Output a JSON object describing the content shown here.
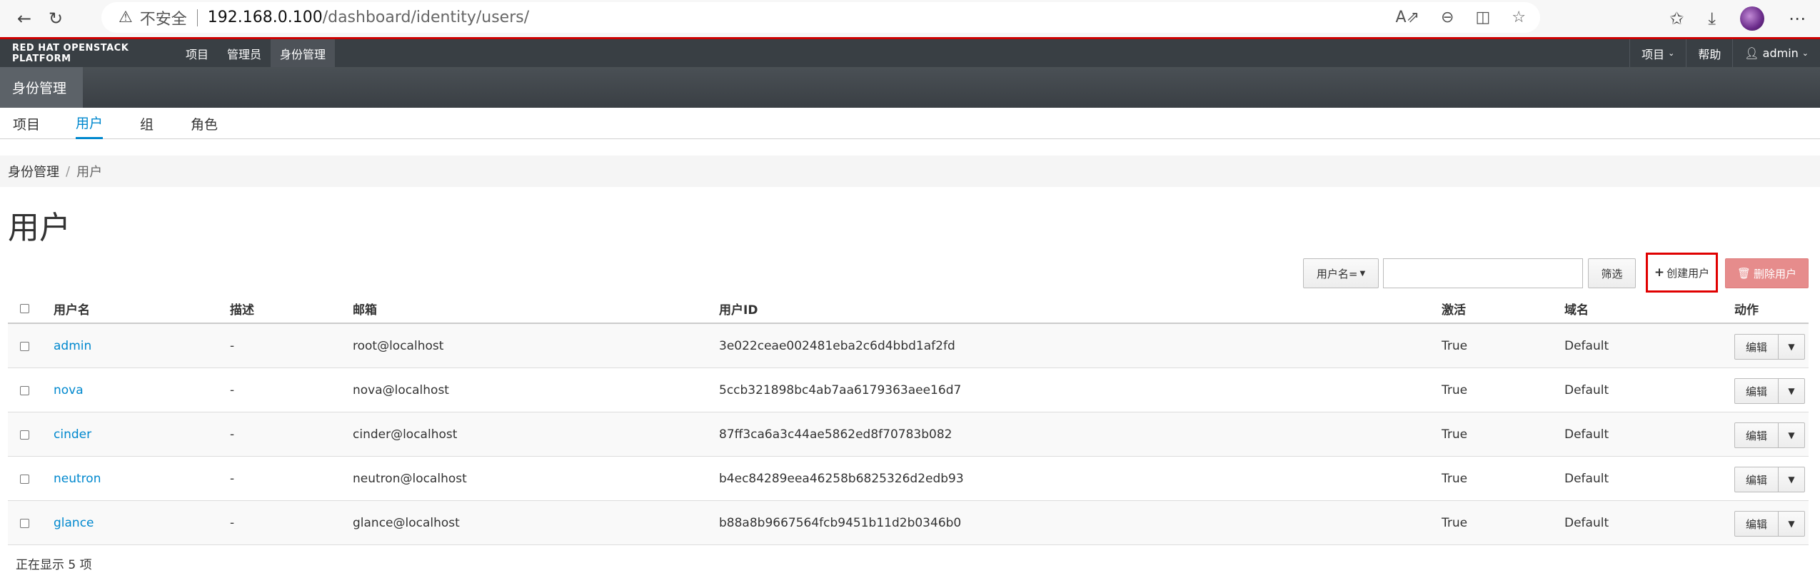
{
  "browser": {
    "insecure_label": "不安全",
    "url_host": "192.168.0.100",
    "url_path": "/dashboard/identity/users/"
  },
  "topbar": {
    "brand": "RED HAT OPENSTACK PLATFORM",
    "nav": [
      "项目",
      "管理员",
      "身份管理"
    ],
    "right": {
      "project": "项目",
      "help": "帮助",
      "user": "admin"
    }
  },
  "subbar": {
    "label": "身份管理"
  },
  "tabs": [
    "项目",
    "用户",
    "组",
    "角色"
  ],
  "breadcrumb": {
    "root": "身份管理",
    "separator": "/",
    "current": "用户"
  },
  "page_title": "用户",
  "toolbar": {
    "filter_select": "用户名=",
    "filter_input": "",
    "filter_button": "筛选",
    "create_button": "创建用户",
    "delete_button": "删除用户"
  },
  "table": {
    "headers": {
      "name": "用户名",
      "desc": "描述",
      "email": "邮箱",
      "id": "用户ID",
      "enabled": "激活",
      "domain": "域名",
      "actions": "动作"
    },
    "rows": [
      {
        "name": "admin",
        "desc": "-",
        "email": "root@localhost",
        "id": "3e022ceae002481eba2c6d4bbd1af2fd",
        "enabled": "True",
        "domain": "Default",
        "edit": "编辑"
      },
      {
        "name": "nova",
        "desc": "-",
        "email": "nova@localhost",
        "id": "5ccb321898bc4ab7aa6179363aee16d7",
        "enabled": "True",
        "domain": "Default",
        "edit": "编辑"
      },
      {
        "name": "cinder",
        "desc": "-",
        "email": "cinder@localhost",
        "id": "87ff3ca6a3c44ae5862ed8f70783b082",
        "enabled": "True",
        "domain": "Default",
        "edit": "编辑"
      },
      {
        "name": "neutron",
        "desc": "-",
        "email": "neutron@localhost",
        "id": "b4ec84289eea46258b6825326d2edb93",
        "enabled": "True",
        "domain": "Default",
        "edit": "编辑"
      },
      {
        "name": "glance",
        "desc": "-",
        "email": "glance@localhost",
        "id": "b88a8b9667564fcb9451b11d2b0346b0",
        "enabled": "True",
        "domain": "Default",
        "edit": "编辑"
      }
    ]
  },
  "footer": {
    "count_text": "正在显示 5 项"
  }
}
